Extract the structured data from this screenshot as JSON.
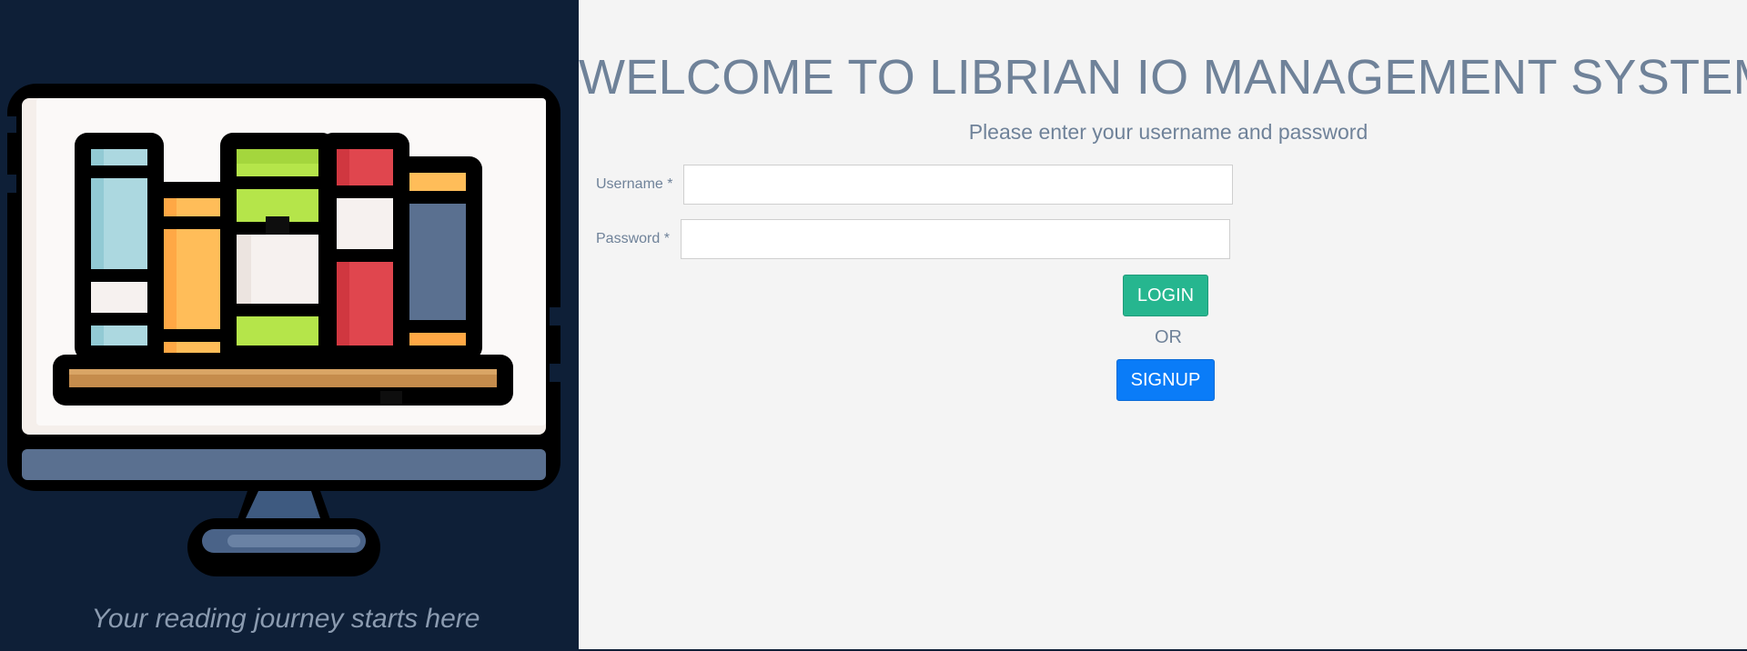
{
  "branding": {
    "tagline": "Your reading journey starts here",
    "illustration": "computer-bookshelf-illustration"
  },
  "login": {
    "title": "WELCOME TO LIBRIAN IO MANAGEMENT SYSTEM",
    "subtitle": "Please enter your username and password",
    "username_label": "Username *",
    "username_value": "",
    "password_label": "Password *",
    "password_value": "",
    "login_button": "LOGIN",
    "or_text": "OR",
    "signup_button": "SIGNUP"
  },
  "colors": {
    "left_background": "#0e1f37",
    "right_background": "#f4f4f4",
    "text_muted": "#6f8299",
    "login_button": "#26b68f",
    "signup_button": "#0a7cf8"
  }
}
